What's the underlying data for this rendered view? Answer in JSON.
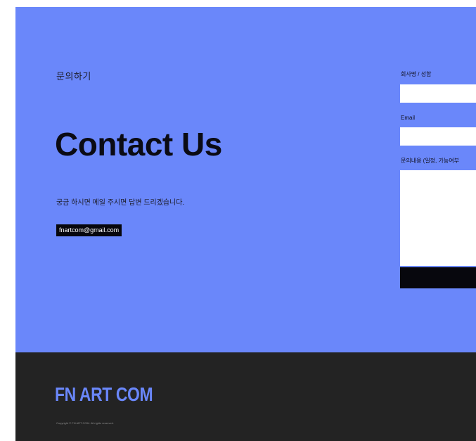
{
  "contact": {
    "kicker": "문의하기",
    "headline": "Contact Us",
    "description": "궁금 하시면 메일 주시면 답변 드리겠습니다.",
    "email": "fnartcom@gmail.com"
  },
  "form": {
    "name_label": "회사명 / 성함",
    "email_label": "Email",
    "message_label": "문의내용 (일정, 가능여부",
    "name_value": "",
    "email_value": "",
    "message_value": "",
    "submit_label": ""
  },
  "footer": {
    "brand": "FN ART COM",
    "copyright": "Copyright © FN ART COM. All rights reserved."
  },
  "colors": {
    "accent": "#6a87fa",
    "dark": "#232323",
    "black": "#07070d"
  }
}
